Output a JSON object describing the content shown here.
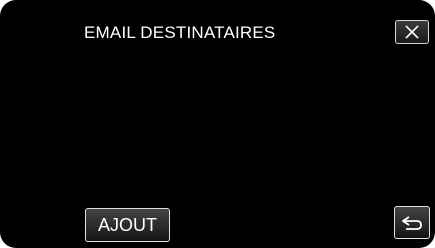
{
  "header": {
    "title": "EMAIL DESTINATAIRES",
    "close_icon": "close-icon"
  },
  "recipients": [],
  "footer": {
    "add_label": "AJOUT",
    "back_icon": "return-arrow-icon"
  },
  "colors": {
    "background": "#000000",
    "text": "#ffffff",
    "button_border": "#e0e0e0"
  }
}
